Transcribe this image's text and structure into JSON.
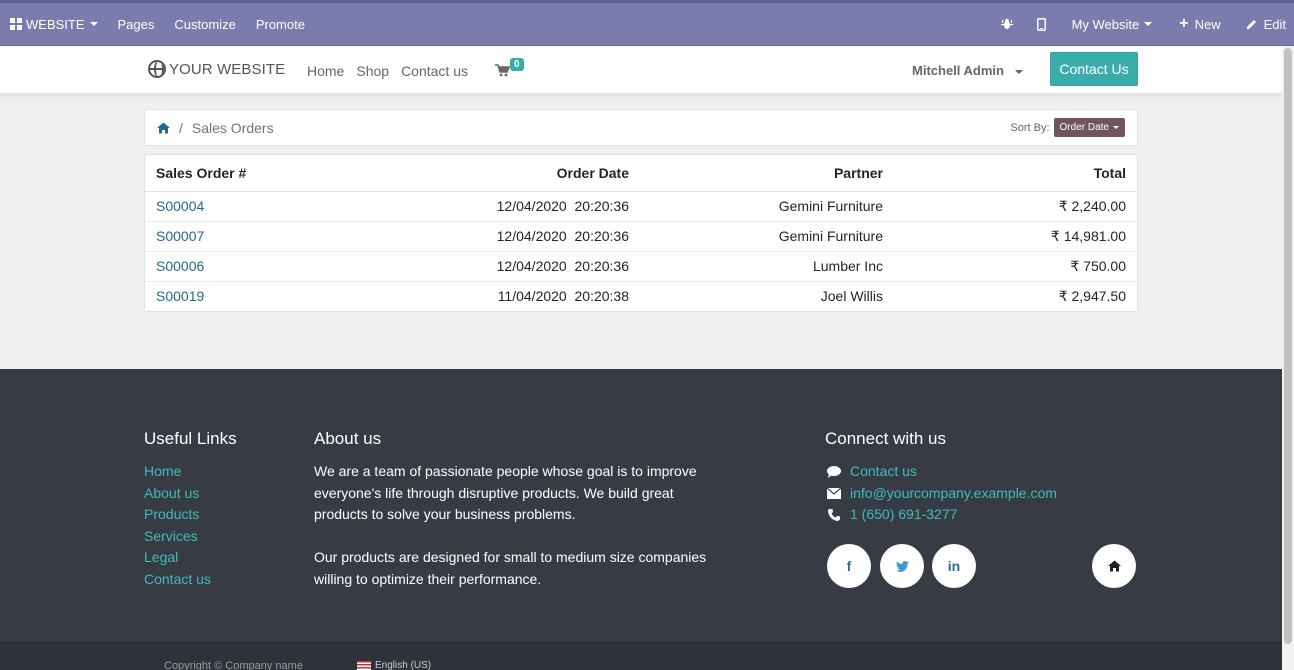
{
  "topbar": {
    "website_menu": "WEBSITE",
    "pages": "Pages",
    "customize": "Customize",
    "promote": "Promote",
    "site_selector": "My Website",
    "new": "New",
    "edit": "Edit"
  },
  "header": {
    "logo": "YOUR WEBSITE",
    "nav": [
      "Home",
      "Shop",
      "Contact us"
    ],
    "cart_count": "0",
    "user": "Mitchell Admin",
    "contact_button": "Contact Us"
  },
  "breadcrumb": {
    "current": "Sales Orders",
    "sort_label": "Sort By:",
    "sort_value": "Order Date"
  },
  "orders": {
    "columns": [
      "Sales Order #",
      "Order Date",
      "Partner",
      "Total"
    ],
    "rows": [
      {
        "number": "S00004",
        "date": "12/04/2020",
        "time": "20:20:36",
        "partner": "Gemini Furniture",
        "total": "₹ 2,240.00"
      },
      {
        "number": "S00007",
        "date": "12/04/2020",
        "time": "20:20:36",
        "partner": "Gemini Furniture",
        "total": "₹ 14,981.00"
      },
      {
        "number": "S00006",
        "date": "12/04/2020",
        "time": "20:20:36",
        "partner": "Lumber Inc",
        "total": "₹ 750.00"
      },
      {
        "number": "S00019",
        "date": "11/04/2020",
        "time": "20:20:38",
        "partner": "Joel Willis",
        "total": "₹ 2,947.50"
      }
    ]
  },
  "footer": {
    "useful_title": "Useful Links",
    "useful_links": [
      "Home",
      "About us",
      "Products",
      "Services",
      "Legal",
      "Contact us"
    ],
    "about_title": "About us",
    "about_p1": "We are a team of passionate people whose goal is to improve everyone's life through disruptive products. We build great products to solve your business problems.",
    "about_p2": "Our products are designed for small to medium size companies willing to optimize their performance.",
    "connect_title": "Connect with us",
    "contact_link": "Contact us",
    "email": "info@yourcompany.example.com",
    "phone": "1 (650) 691-3277",
    "social": [
      "f",
      "in"
    ]
  },
  "copyright": {
    "text": "Copyright © Company name",
    "language": "English (US)"
  },
  "colors": {
    "topbar": "#7c7bad",
    "accent": "#3aadaa",
    "footer": "#373b43",
    "link": "#1e6b8c"
  }
}
